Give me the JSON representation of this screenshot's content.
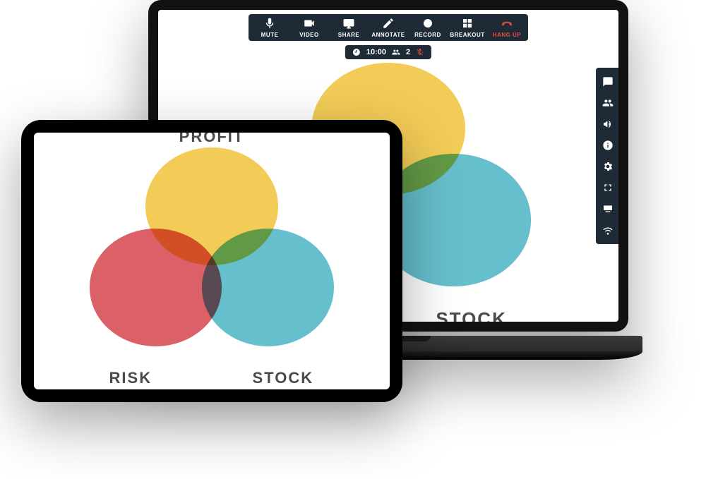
{
  "colors": {
    "yellow": "#f2c744",
    "red": "#d94e56",
    "blue": "#55b8c7",
    "hangup": "#e74c3c",
    "panel": "#1e2a36"
  },
  "toolbar": {
    "mute": "MUTE",
    "video": "VIDEO",
    "share": "SHARE",
    "annotate": "ANNOTATE",
    "record": "RECORD",
    "breakout": "BREAKOUT",
    "hangup": "HANG UP"
  },
  "status": {
    "timer": "10:00",
    "participants": "2"
  },
  "venn": {
    "profit": "PROFIT",
    "risk": "RISK",
    "stock": "STOCK"
  },
  "chart_data": {
    "type": "venn",
    "sets": [
      {
        "name": "PROFIT",
        "color": "#f2c744"
      },
      {
        "name": "RISK",
        "color": "#d94e56"
      },
      {
        "name": "STOCK",
        "color": "#55b8c7"
      }
    ],
    "overlaps": [
      "PROFIT∩RISK",
      "PROFIT∩STOCK",
      "RISK∩STOCK",
      "PROFIT∩RISK∩STOCK"
    ]
  }
}
